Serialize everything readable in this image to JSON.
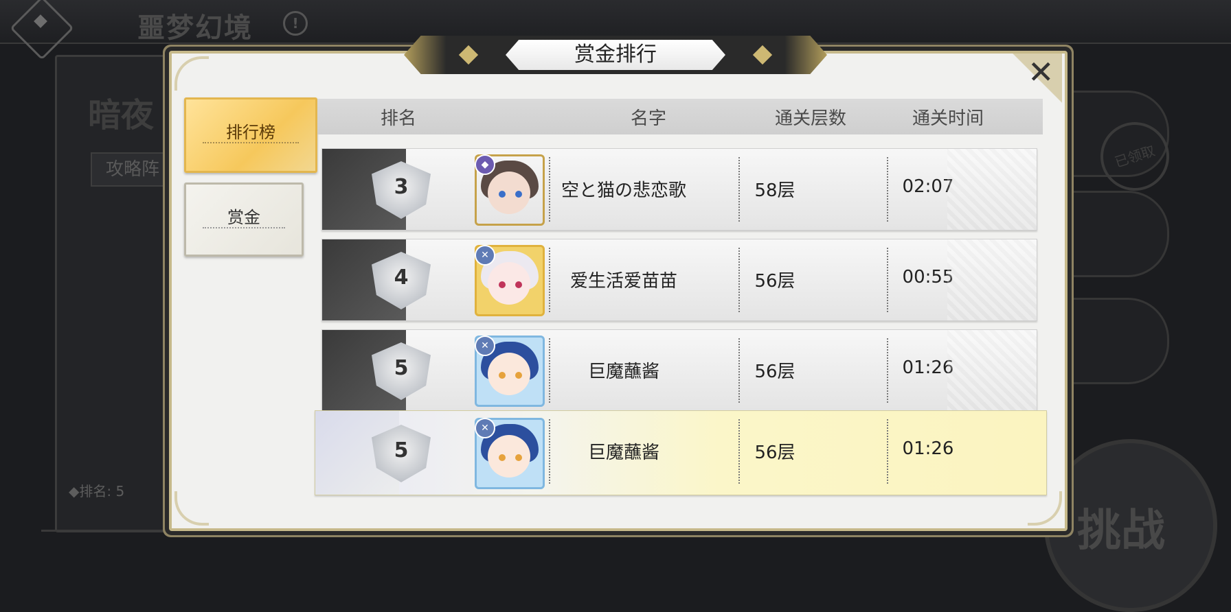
{
  "background": {
    "title": "噩梦幻境",
    "info_icon": "!",
    "panel_title": "暗夜",
    "strategy_button": "攻略阵",
    "rank_text": "◆排名: 5",
    "stamp_text": "已领取",
    "challenge_label": "挑战"
  },
  "modal": {
    "title": "赏金排行",
    "close_icon": "close-icon",
    "tabs": [
      {
        "label": "排行榜",
        "active": true
      },
      {
        "label": "赏金",
        "active": false
      }
    ],
    "columns": {
      "rank": "排名",
      "name": "名字",
      "floor": "通关层数",
      "time": "通关时间"
    },
    "rows": [
      {
        "rank": "3",
        "name": "空と猫の悲恋歌",
        "floor": "58层",
        "time": "02:07",
        "avatar": "dark-hair-girl"
      },
      {
        "rank": "4",
        "name": "爱生活爱苗苗",
        "floor": "56层",
        "time": "00:55",
        "avatar": "white-hair-girl"
      },
      {
        "rank": "5",
        "name": "巨魔蘸酱",
        "floor": "56层",
        "time": "01:26",
        "avatar": "blue-hair-girl"
      }
    ],
    "my_row": {
      "rank": "5",
      "name": "巨魔蘸酱",
      "floor": "56层",
      "time": "01:26",
      "avatar": "blue-hair-girl"
    }
  },
  "colors": {
    "accent_gold": "#c6b98a",
    "active_tab": "#f6c85c",
    "highlight_row": "#fbf4c0"
  }
}
